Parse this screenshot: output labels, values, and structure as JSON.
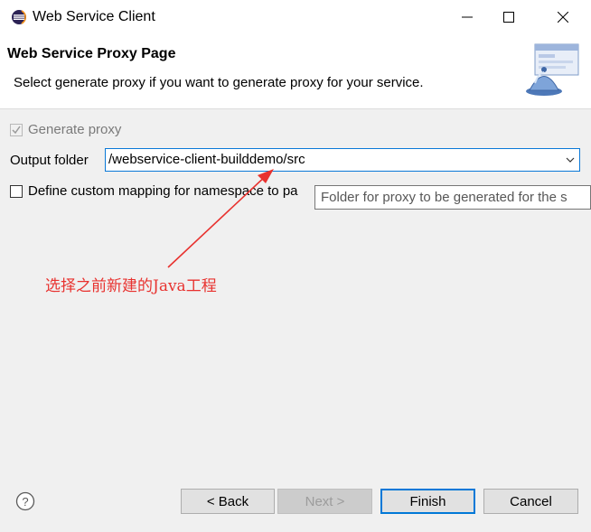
{
  "window": {
    "title": "Web Service Client",
    "icon": "eclipse-icon"
  },
  "header": {
    "title": "Web Service Proxy Page",
    "description": "Select generate proxy if you want to generate proxy for your service."
  },
  "form": {
    "generate_proxy": {
      "label": "Generate proxy",
      "checked": true,
      "enabled": false
    },
    "output_folder": {
      "label": "Output folder",
      "value": "/webservice-client-builddemo/src"
    },
    "custom_mapping": {
      "label": "Define custom mapping for namespace to pa",
      "checked": false
    }
  },
  "tooltip": {
    "text": "Folder for proxy to be generated for the s"
  },
  "annotation": {
    "text": "选择之前新建的Java工程",
    "color": "#e8322f"
  },
  "buttons": {
    "back": "< Back",
    "next": "Next >",
    "finish": "Finish",
    "cancel": "Cancel"
  },
  "colors": {
    "accent": "#0078d7",
    "annotation": "#e8322f"
  }
}
